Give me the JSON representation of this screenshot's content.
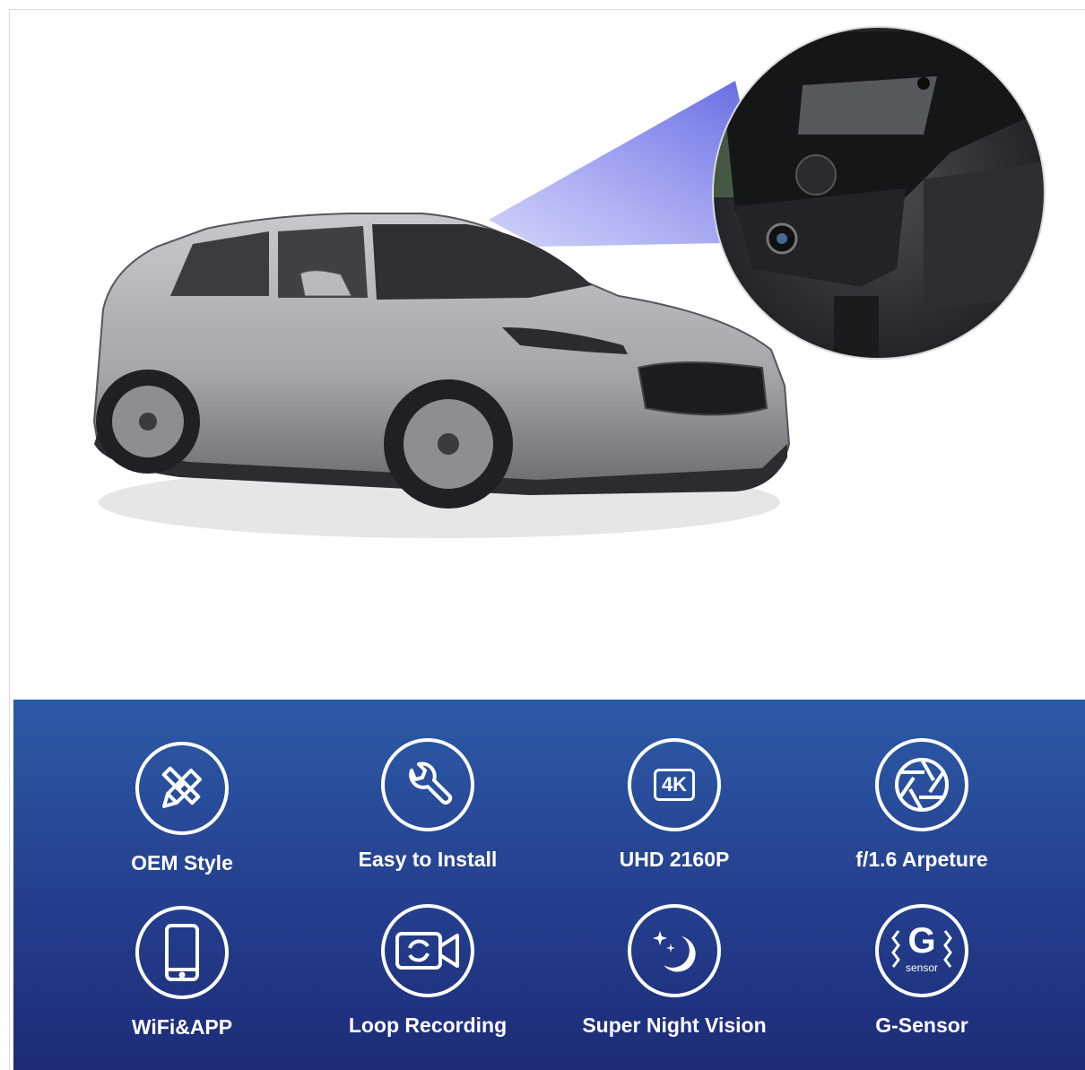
{
  "features": [
    {
      "label": "OEM Style",
      "icon": "tools-icon"
    },
    {
      "label": "Easy to Install",
      "icon": "wrench-icon"
    },
    {
      "label": "UHD 2160P",
      "icon": "4k-icon",
      "badge": "4K"
    },
    {
      "label": "f/1.6 Arpeture",
      "icon": "aperture-icon"
    },
    {
      "label": "WiFi&APP",
      "icon": "smartphone-icon"
    },
    {
      "label": "Loop Recording",
      "icon": "video-loop-icon"
    },
    {
      "label": "Super Night Vision",
      "icon": "moon-stars-icon"
    },
    {
      "label": "G-Sensor",
      "icon": "g-sensor-icon",
      "badge": "G",
      "sub": "sensor"
    }
  ],
  "colors": {
    "panel_top": "#2c5aa6",
    "panel_bottom": "#1d2b77",
    "car_body": "#a9a9ae",
    "beam": "#6b6fe0"
  }
}
